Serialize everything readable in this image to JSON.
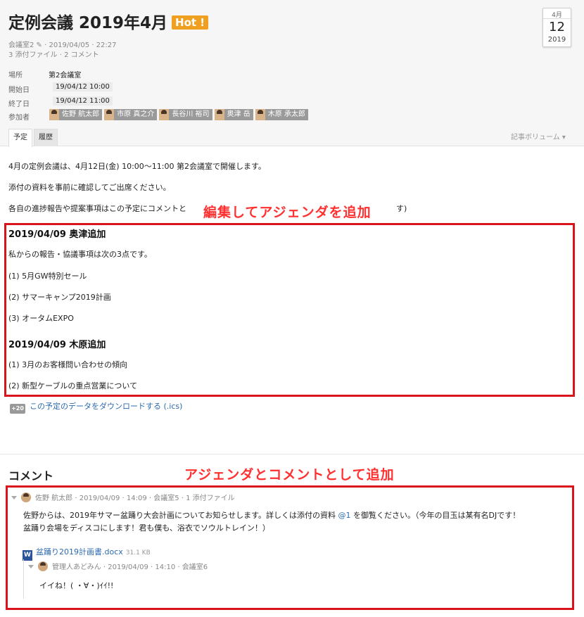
{
  "event": {
    "title": "定例会議 2019年4月",
    "hot_badge": "Hot !",
    "meta_line": "会議室2 ✎ · 2019/04/05 · 22:27",
    "counts_line": "3 添付ファイル · 2 コメント",
    "calendar": {
      "month": "4月",
      "day": "12",
      "year": "2019"
    }
  },
  "details": {
    "location_label": "場所",
    "location_value": "第2会議室",
    "start_label": "開始日",
    "start_value": "19/04/12 10:00",
    "end_label": "終了日",
    "end_value": "19/04/12 11:00",
    "attendees_label": "参加者",
    "attendees": [
      "佐野 航太郎",
      "市原 真之介",
      "長谷川 裕司",
      "奥津 岳",
      "木原 承太郎"
    ]
  },
  "tabs": [
    "予定",
    "履歴"
  ],
  "volume_label": "記事ボリューム ▾",
  "body": {
    "p1": "4月の定例会議は、4月12日(金) 10:00〜11:00 第2会議室で開催します。",
    "p2": "添付の資料を事前に確認してご出席ください。",
    "p3": "各自の進捗報告や提案事項はこの予定にコメントと",
    "p3_tail": "す)",
    "section1_heading": "2019/04/09 奥津追加",
    "section1_intro": "私からの報告・協議事項は次の3点です。",
    "section1_items": [
      "(1) 5月GW特別セール",
      "(2) サマーキャンプ2019計画",
      "(3) オータムEXPO"
    ],
    "section2_heading": "2019/04/09 木原追加",
    "section2_items": [
      "(1) 3月のお客様問い合わせの傾向",
      "(2) 新型ケーブルの重点営業について"
    ]
  },
  "annotations": {
    "edit_note": "編集してアジェンダを追加",
    "comment_note": "アジェンダとコメントとして追加"
  },
  "download": {
    "icon_text": "+20",
    "label": "この予定のデータをダウンロードする (.ics)"
  },
  "comments": {
    "section_title": "コメント",
    "c1_head": "佐野 航太郎 · 2019/04/09 · 14:09 · 会議室5 · 1 添付ファイル",
    "c1_text_a": "佐野からは、2019年サマー盆踊り大会計画についてお知らせします。詳しくは添付の資料 ",
    "c1_mention": "@1",
    "c1_text_b": " を御覧ください。（今年の目玉は某有名DJです！",
    "c1_line2": "盆踊り会場をディスコにします！君も僕も、浴衣でソウルトレイン！）",
    "file_icon": "W",
    "file_name": "盆踊り2019計画書.docx",
    "file_size": "31.1 KB",
    "c2_head": "管理人あどみん · 2019/04/09 · 14:10 · 会議室6",
    "c2_text": "イイね！( ・∀・)ｲｲ!!"
  },
  "colors": {
    "accent_red": "#d9141c",
    "hot_orange": "#f0a020",
    "link_blue": "#2b6ab0"
  }
}
